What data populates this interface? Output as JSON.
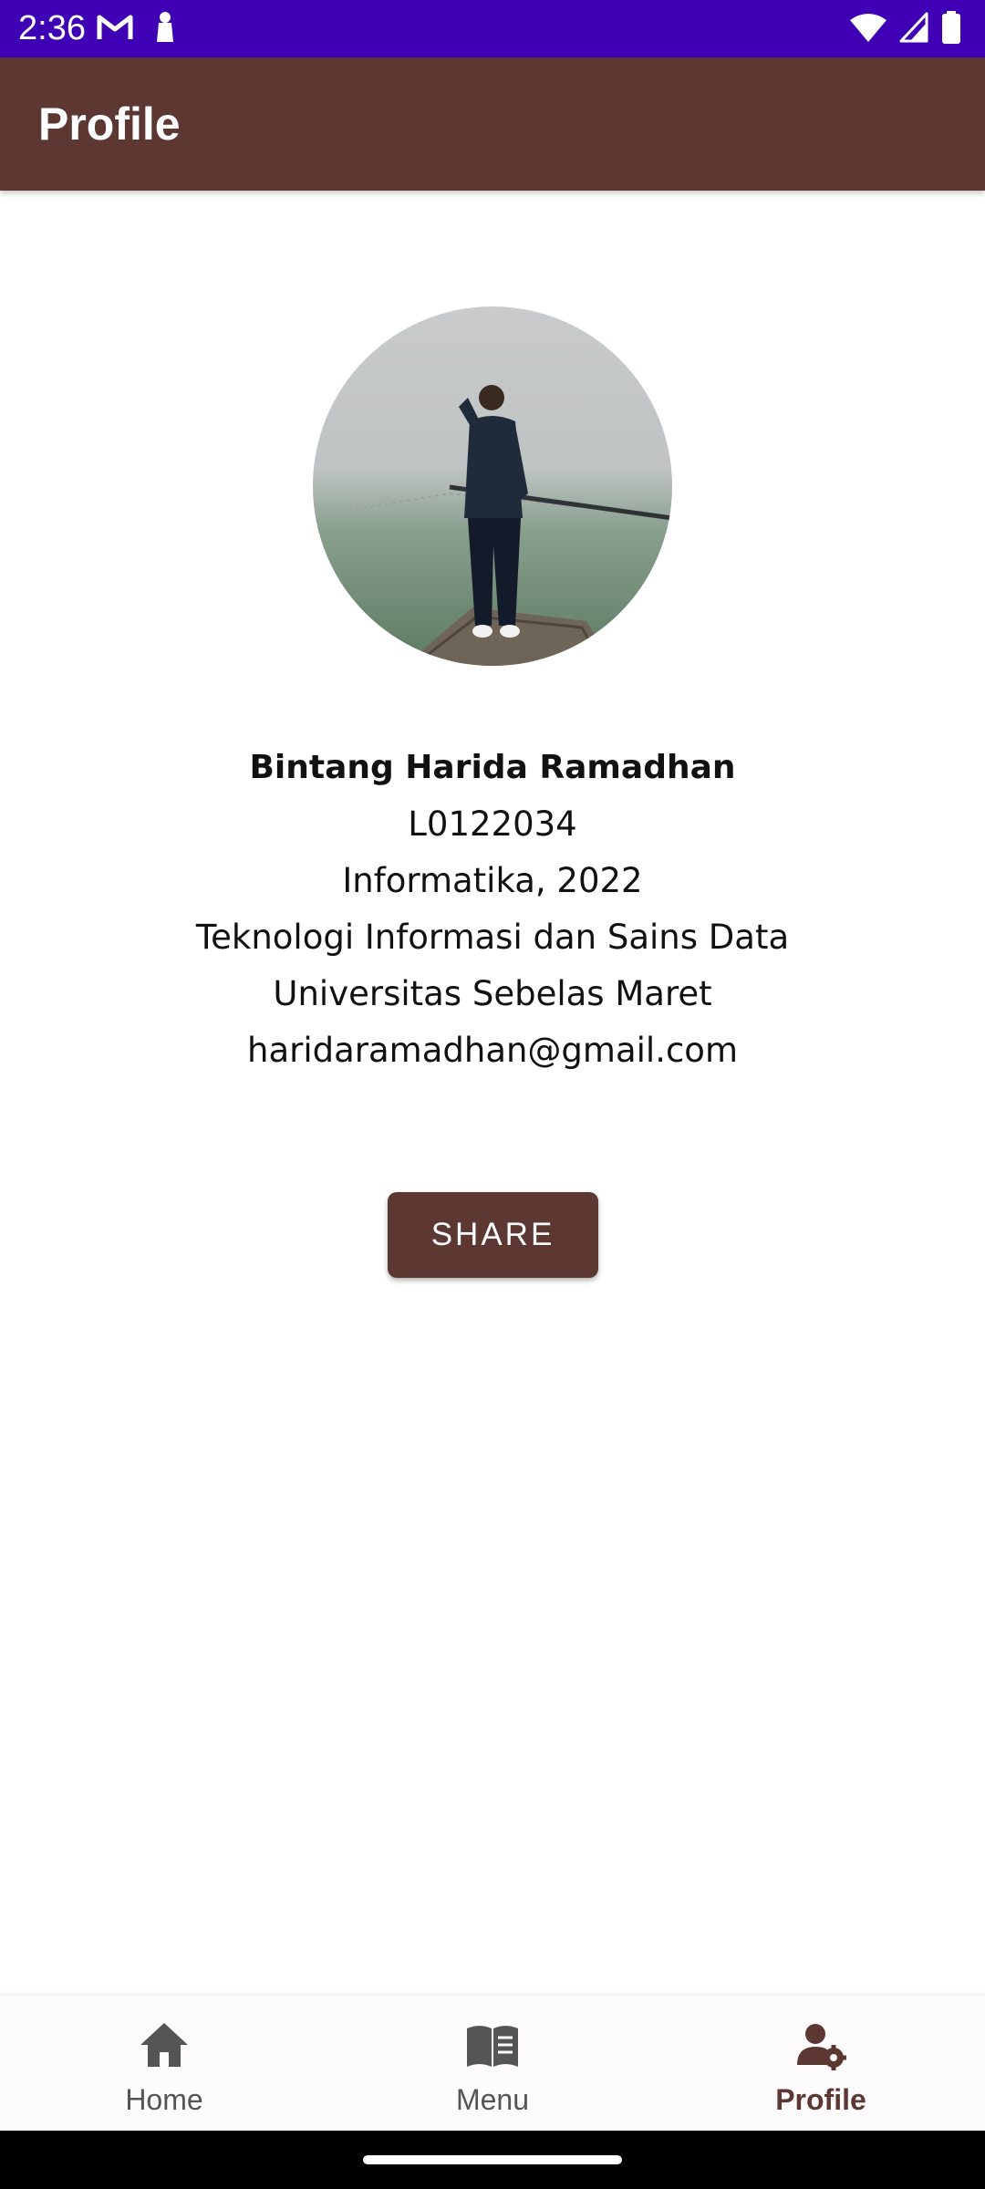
{
  "status_bar": {
    "time": "2:36",
    "background": "#3f00b5",
    "left_icons": [
      "gmail-icon",
      "notification-icon"
    ],
    "right_icons": [
      "wifi-icon",
      "signal-icon",
      "battery-icon"
    ]
  },
  "app_bar": {
    "title": "Profile",
    "background": "#5d3833"
  },
  "profile": {
    "photo": "avatar",
    "name": "Bintang Harida Ramadhan",
    "student_id": "L0122034",
    "program": "Informatika, 2022",
    "faculty": "Teknologi Informasi dan Sains Data",
    "university": "Universitas Sebelas Maret",
    "email": "haridaramadhan@gmail.com"
  },
  "actions": {
    "share_label": "SHARE",
    "button_color": "#5d3833"
  },
  "bottom_nav": {
    "items": [
      {
        "label": "Home",
        "icon": "home-icon",
        "active": false
      },
      {
        "label": "Menu",
        "icon": "book-icon",
        "active": false
      },
      {
        "label": "Profile",
        "icon": "profile-settings-icon",
        "active": true
      }
    ],
    "active_color": "#5d3833",
    "inactive_color": "#555555"
  }
}
